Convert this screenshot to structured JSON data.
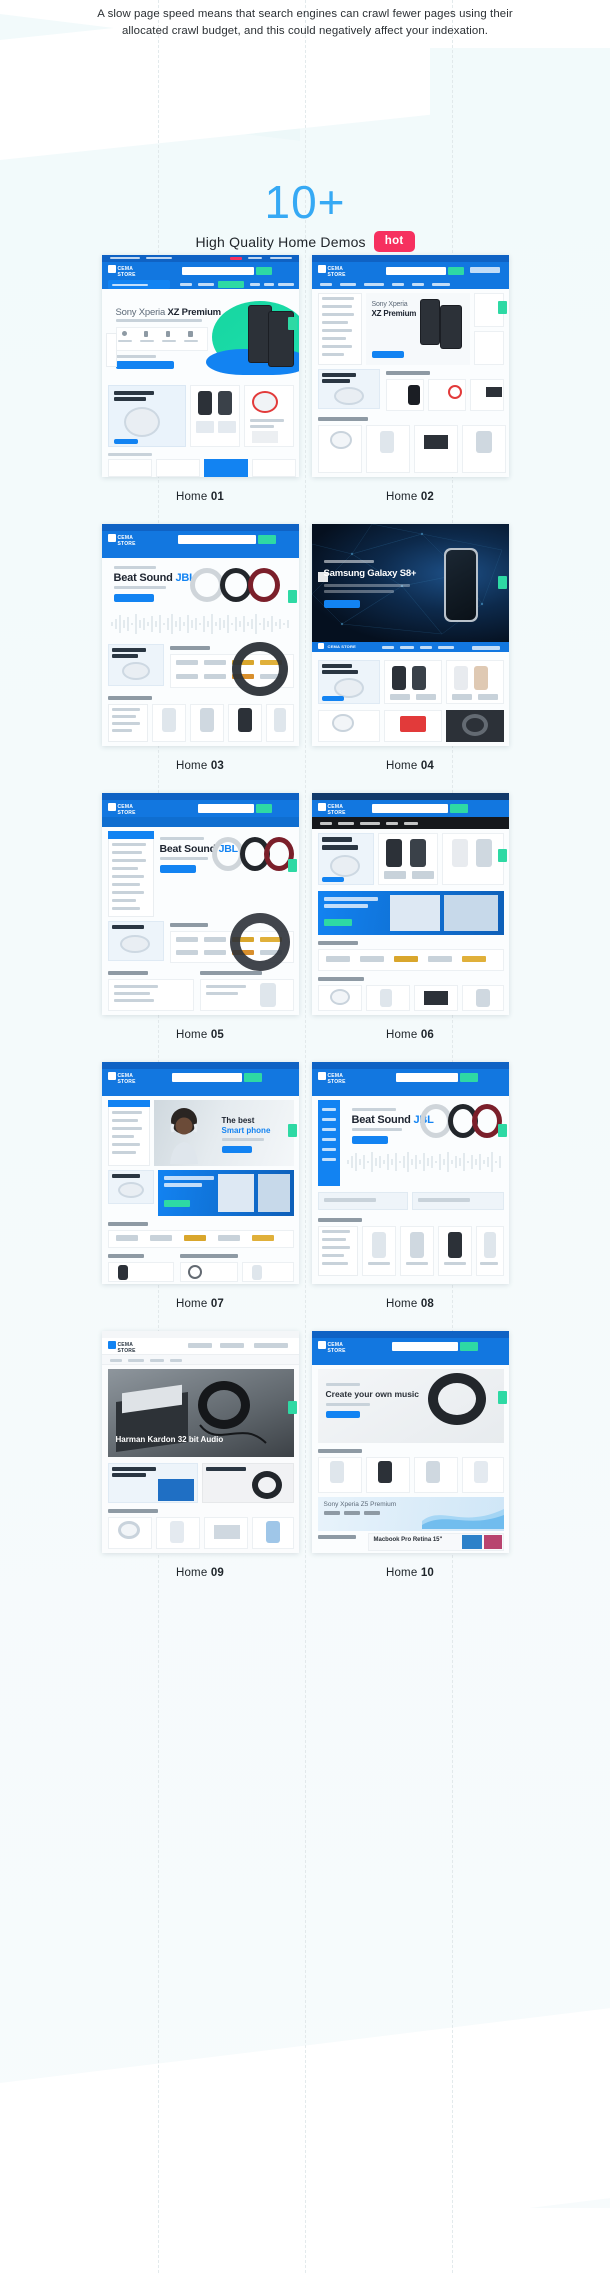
{
  "intro": {
    "paragraph": "A slow page speed means that search engines can crawl fewer pages using their allocated crawl budget, and this could negatively affect your indexation."
  },
  "heading": {
    "count": "10+",
    "subtitle": "High Quality Home Demos",
    "badge": "hot",
    "count_color": "#36a9f4",
    "badge_color": "#f6305f"
  },
  "demos": [
    {
      "caption_prefix": "Home ",
      "caption_num": "01",
      "brand": "CEMA STORE",
      "hero_light": "Sony Xperia ",
      "hero_bold": "XZ Premium",
      "hero_sub": "THE BEST NEW SMARTPHONE IN MID 2017",
      "cta": "SHOP NOW AND SAVE EXTRA",
      "section": "THE BEST SMARTPHONE",
      "nav": [
        "Home",
        "Products",
        "Electronics",
        "Blog",
        "Pages",
        "Contact Us"
      ],
      "theme": "light-blue"
    },
    {
      "caption_prefix": "Home ",
      "caption_num": "02",
      "brand": "CEMA STORE",
      "hero_light": "Sony Xperia ",
      "hero_bold": "XZ Premium",
      "promo": "NEW MACBOOK PRO RETINA",
      "section": "Featured Categories",
      "section2": "TOP SELLING BY THIS MONTH",
      "theme": "light-sidebar"
    },
    {
      "caption_prefix": "Home ",
      "caption_num": "03",
      "brand": "CEMA STORE",
      "hero_light": "Beat Sound ",
      "hero_bold": "JBL",
      "hero_sub": "New Technologies 2017",
      "section": "NEW MACBOOK PRO RETINA",
      "section2": "BESTSELLER BRANDS",
      "section3": "MOBILE - SMARTPHONE",
      "theme": "wave"
    },
    {
      "caption_prefix": "Home ",
      "caption_num": "04",
      "brand": "CEMA STORE",
      "hero_sub": "The Future Has Come",
      "hero_bold": "Samsung Galaxy S8+",
      "cta": "SHOP NOW",
      "section": "THE BEST SMARTPHONE",
      "theme": "dark"
    },
    {
      "caption_prefix": "Home ",
      "caption_num": "05",
      "brand": "CEMA STORE",
      "hero_light": "Beat Sound ",
      "hero_bold": "JBL",
      "hero_sub": "New Technologies 2017",
      "section": "BESTSELLER BRANDS",
      "section2": "DEAL OF THE DAY",
      "section3": "BEST PRICE IN THIS MONTH",
      "theme": "sidebar-hero"
    },
    {
      "caption_prefix": "Home ",
      "caption_num": "06",
      "brand": "CEMA STORE",
      "hero_bold": "THE BEST SMARTPHONE",
      "promo": "NEW MACBOOK PRO RETINA",
      "promo2": "SAVE ON A NEW MACBOOK PRO FOR TRAVEL",
      "section": "BESTSELLER BRANDS",
      "section2": "FEATURED PRODUCTS",
      "theme": "dark-nav"
    },
    {
      "caption_prefix": "Home ",
      "caption_num": "07",
      "brand": "CEMA STORE",
      "hero_bold": "The best Smart phone",
      "hero_sub": "For your lifestyle",
      "promo": "NEW MACBOOK PRO RETINA",
      "promo2": "SAVE ON A NEW MACBOOK PRO FOR TRAVEL",
      "section": "BESTSELLER BRANDS",
      "section2": "DEAL OF THE DAY",
      "section3": "BEST PRICE IN THIS MONTH",
      "theme": "person"
    },
    {
      "caption_prefix": "Home ",
      "caption_num": "08",
      "brand": "CEMA STORE",
      "hero_light": "Beat Sound ",
      "hero_bold": "JBL",
      "hero_sub": "New Technologies 2017",
      "section": "MOBILE - SMARTPHONE",
      "theme": "wave-sidebar"
    },
    {
      "caption_prefix": "Home ",
      "caption_num": "09",
      "brand": "CEMA STORE",
      "hero_bold": "Harman Kardon 32 bit Audio",
      "promo": "SAVE ON A NEW MACBOOK PRO FOR TRAVEL",
      "promo2": "HARMAN KARDON BEATS",
      "section": "TOP SELLER BY THIS MONTH",
      "theme": "grey-hero"
    },
    {
      "caption_prefix": "Home ",
      "caption_num": "10",
      "brand": "CEMA STORE",
      "hero_bold": "Create your own music",
      "hero_sub": "THE BEAD HEAD AUDIO",
      "section": "MOBILE - SMARTPHONE",
      "section2": "Sony Xperia Z5 Premium",
      "section3": "LATEST - MACBOOK",
      "section4": "Macbook Pro Retina 15\"",
      "promo": "NEW MACBOOK PRO RETINA",
      "theme": "music"
    }
  ]
}
